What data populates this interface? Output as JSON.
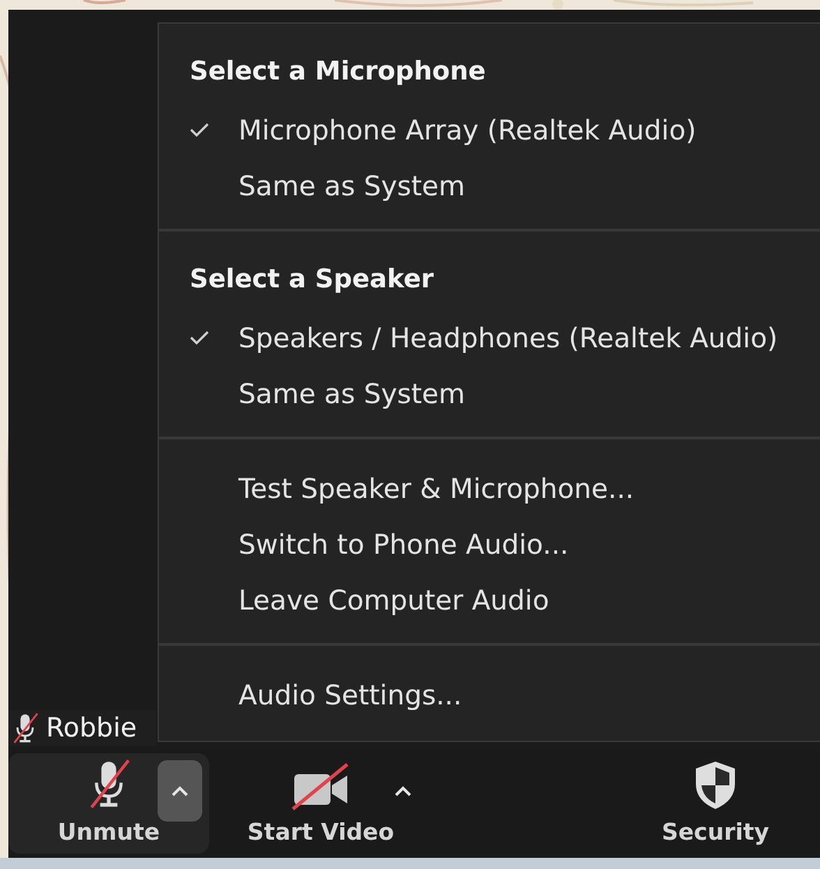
{
  "audio_menu": {
    "sections": [
      {
        "heading": "Select a Microphone",
        "items": [
          {
            "label": "Microphone Array (Realtek Audio)",
            "checked": true
          },
          {
            "label": "Same as System",
            "checked": false
          }
        ]
      },
      {
        "heading": "Select a Speaker",
        "items": [
          {
            "label": "Speakers / Headphones (Realtek Audio)",
            "checked": true
          },
          {
            "label": "Same as System",
            "checked": false
          }
        ]
      },
      {
        "items": [
          {
            "label": "Test Speaker & Microphone..."
          },
          {
            "label": "Switch to Phone Audio..."
          },
          {
            "label": "Leave Computer Audio"
          }
        ]
      },
      {
        "items": [
          {
            "label": "Audio Settings..."
          }
        ]
      }
    ]
  },
  "participant": {
    "name": "Robbie",
    "muted": true
  },
  "toolbar": {
    "buttons": [
      {
        "kind": "mic",
        "label": "Unmute",
        "off": true,
        "highlighted": true,
        "has_menu": true,
        "menu_open": true
      },
      {
        "kind": "video",
        "label": "Start Video",
        "off": true,
        "highlighted": false,
        "has_menu": true,
        "menu_open": false
      },
      {
        "kind": "security",
        "label": "Security",
        "highlighted": false,
        "has_menu": false
      }
    ]
  }
}
